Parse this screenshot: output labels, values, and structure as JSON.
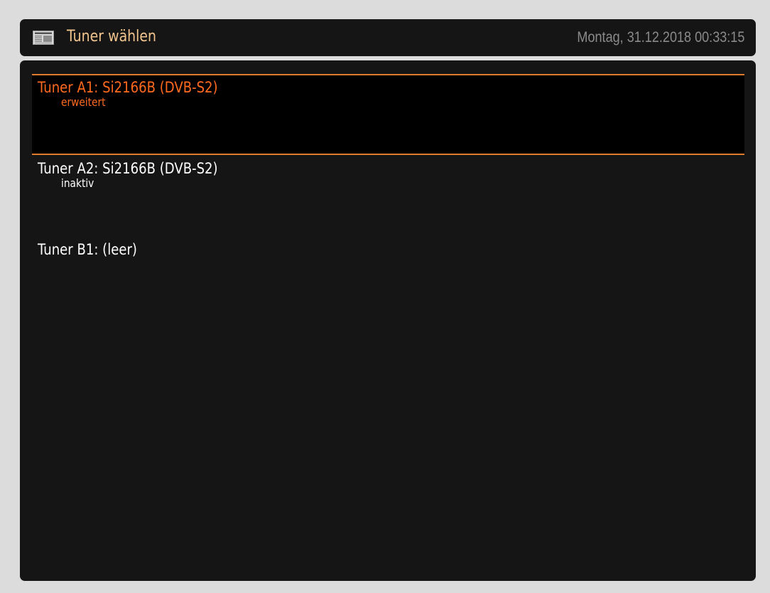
{
  "header": {
    "icon": "newspaper-icon",
    "title": "Tuner wählen",
    "datetime": "Montag, 31.12.2018  00:33:15"
  },
  "tuners": [
    {
      "name": "Tuner A1: Si2166B (DVB-S2)",
      "status": "erweitert",
      "selected": true
    },
    {
      "name": "Tuner A2: Si2166B (DVB-S2)",
      "status": "inaktiv",
      "selected": false
    },
    {
      "name": "Tuner B1: (leer)",
      "status": "",
      "selected": false
    }
  ],
  "colors": {
    "background": "#dcdcdc",
    "panel": "#151515",
    "title": "#f0c48c",
    "selection_accent": "#e07a2c",
    "selected_text": "#ff6a1f",
    "datetime": "#8a8a8a"
  }
}
